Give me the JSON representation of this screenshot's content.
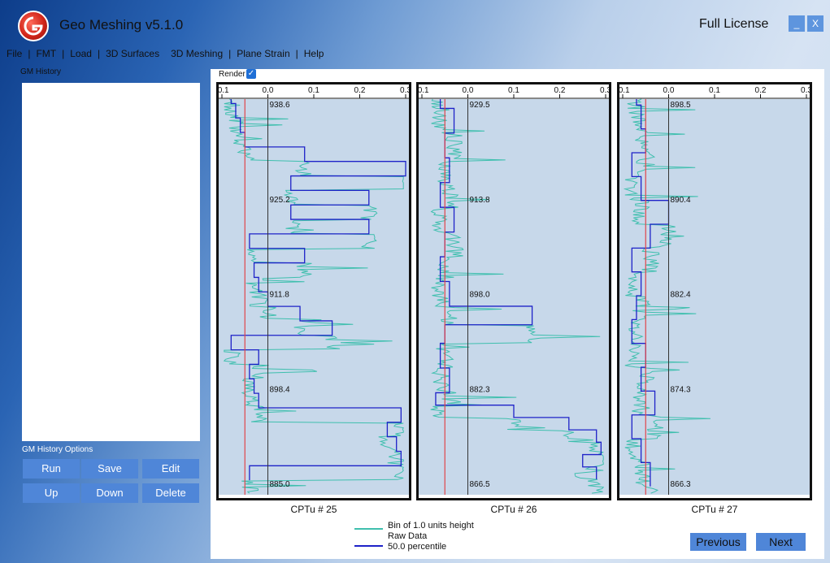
{
  "app": {
    "title": "Geo Meshing v5.1.0",
    "license": "Full License",
    "minimize": "_",
    "close": "X"
  },
  "menu": [
    "File",
    "FMT",
    "Load",
    "3D Surfaces",
    "3D Meshing",
    "Plane Strain",
    "Help"
  ],
  "menu_separator": "|",
  "history": {
    "label": "GM History",
    "options_label": "GM History Options"
  },
  "buttons": {
    "run": "Run",
    "save": "Save",
    "edit": "Edit",
    "up": "Up",
    "down": "Down",
    "delete": "Delete"
  },
  "render": {
    "label": "Render",
    "checked": true
  },
  "colors": {
    "raw": "#3fbfae",
    "bin": "#1e22c8",
    "ref": "#e0454a",
    "plot_bg": "#c7d8ea",
    "accent": "#4f86d8"
  },
  "legend": [
    "Bin of 1.0 units height",
    "Raw Data",
    "50.0 percentile"
  ],
  "nav": {
    "previous": "Previous",
    "next": "Next"
  },
  "chart_data": [
    {
      "type": "line",
      "title": "CPTu # 25",
      "xlim": [
        -0.1,
        0.3
      ],
      "x_ticks": [
        "-0.1",
        "0.0",
        "0.1",
        "0.2",
        "0.3"
      ],
      "y_labels": [
        "938.6",
        "925.2",
        "911.8",
        "898.4",
        "885.0"
      ],
      "reference_x": -0.05,
      "zero_x": 0.0,
      "bins": [
        [
          938,
          -0.08
        ],
        [
          936,
          -0.07
        ],
        [
          934,
          -0.06
        ],
        [
          932,
          -0.05
        ],
        [
          930,
          0.08
        ],
        [
          928,
          0.3
        ],
        [
          926,
          0.05
        ],
        [
          924,
          0.22
        ],
        [
          922,
          0.05
        ],
        [
          920,
          0.22
        ],
        [
          918,
          -0.04
        ],
        [
          916,
          0.08
        ],
        [
          914,
          -0.03
        ],
        [
          912,
          -0.02
        ],
        [
          910,
          0.0
        ],
        [
          908,
          0.07
        ],
        [
          906,
          0.14
        ],
        [
          904,
          -0.08
        ],
        [
          902,
          -0.02
        ],
        [
          900,
          -0.04
        ],
        [
          898,
          -0.03
        ],
        [
          896,
          -0.02
        ],
        [
          894,
          0.29
        ],
        [
          892,
          0.26
        ],
        [
          890,
          0.28
        ],
        [
          888,
          0.29
        ],
        [
          886,
          -0.04
        ]
      ]
    },
    {
      "type": "line",
      "title": "CPTu # 26",
      "xlim": [
        -0.1,
        0.3
      ],
      "x_ticks": [
        "-0.1",
        "0.0",
        "0.1",
        "0.2",
        "0.3"
      ],
      "y_labels": [
        "929.5",
        "913.8",
        "898.0",
        "882.3",
        "866.5"
      ],
      "reference_x": -0.05,
      "zero_x": 0.0,
      "bins": [
        [
          928,
          -0.06
        ],
        [
          924,
          -0.03
        ],
        [
          920,
          -0.05
        ],
        [
          916,
          -0.04
        ],
        [
          912,
          -0.06
        ],
        [
          908,
          -0.03
        ],
        [
          904,
          -0.05
        ],
        [
          900,
          -0.06
        ],
        [
          896,
          -0.04
        ],
        [
          893,
          0.14
        ],
        [
          890,
          -0.05
        ],
        [
          886,
          -0.06
        ],
        [
          882,
          -0.04
        ],
        [
          880,
          -0.07
        ],
        [
          878,
          0.1
        ],
        [
          876,
          0.22
        ],
        [
          874,
          0.28
        ],
        [
          872,
          0.29
        ],
        [
          870,
          0.25
        ],
        [
          868,
          0.28
        ]
      ]
    },
    {
      "type": "line",
      "title": "CPTu # 27",
      "xlim": [
        -0.1,
        0.3
      ],
      "x_ticks": [
        "-0.1",
        "0.0",
        "0.1",
        "0.2",
        "0.3"
      ],
      "y_labels": [
        "898.5",
        "890.4",
        "882.4",
        "874.3",
        "866.3"
      ],
      "reference_x": -0.05,
      "zero_x": 0.0,
      "bins": [
        [
          898,
          -0.07
        ],
        [
          896,
          -0.06
        ],
        [
          894,
          -0.05
        ],
        [
          892,
          -0.08
        ],
        [
          890,
          -0.06
        ],
        [
          888,
          0.0
        ],
        [
          886,
          -0.04
        ],
        [
          884,
          -0.08
        ],
        [
          882,
          -0.06
        ],
        [
          880,
          -0.07
        ],
        [
          878,
          -0.08
        ],
        [
          876,
          -0.05
        ],
        [
          874,
          -0.06
        ],
        [
          872,
          -0.03
        ],
        [
          870,
          -0.08
        ],
        [
          868,
          -0.06
        ],
        [
          866,
          -0.04
        ]
      ]
    }
  ]
}
